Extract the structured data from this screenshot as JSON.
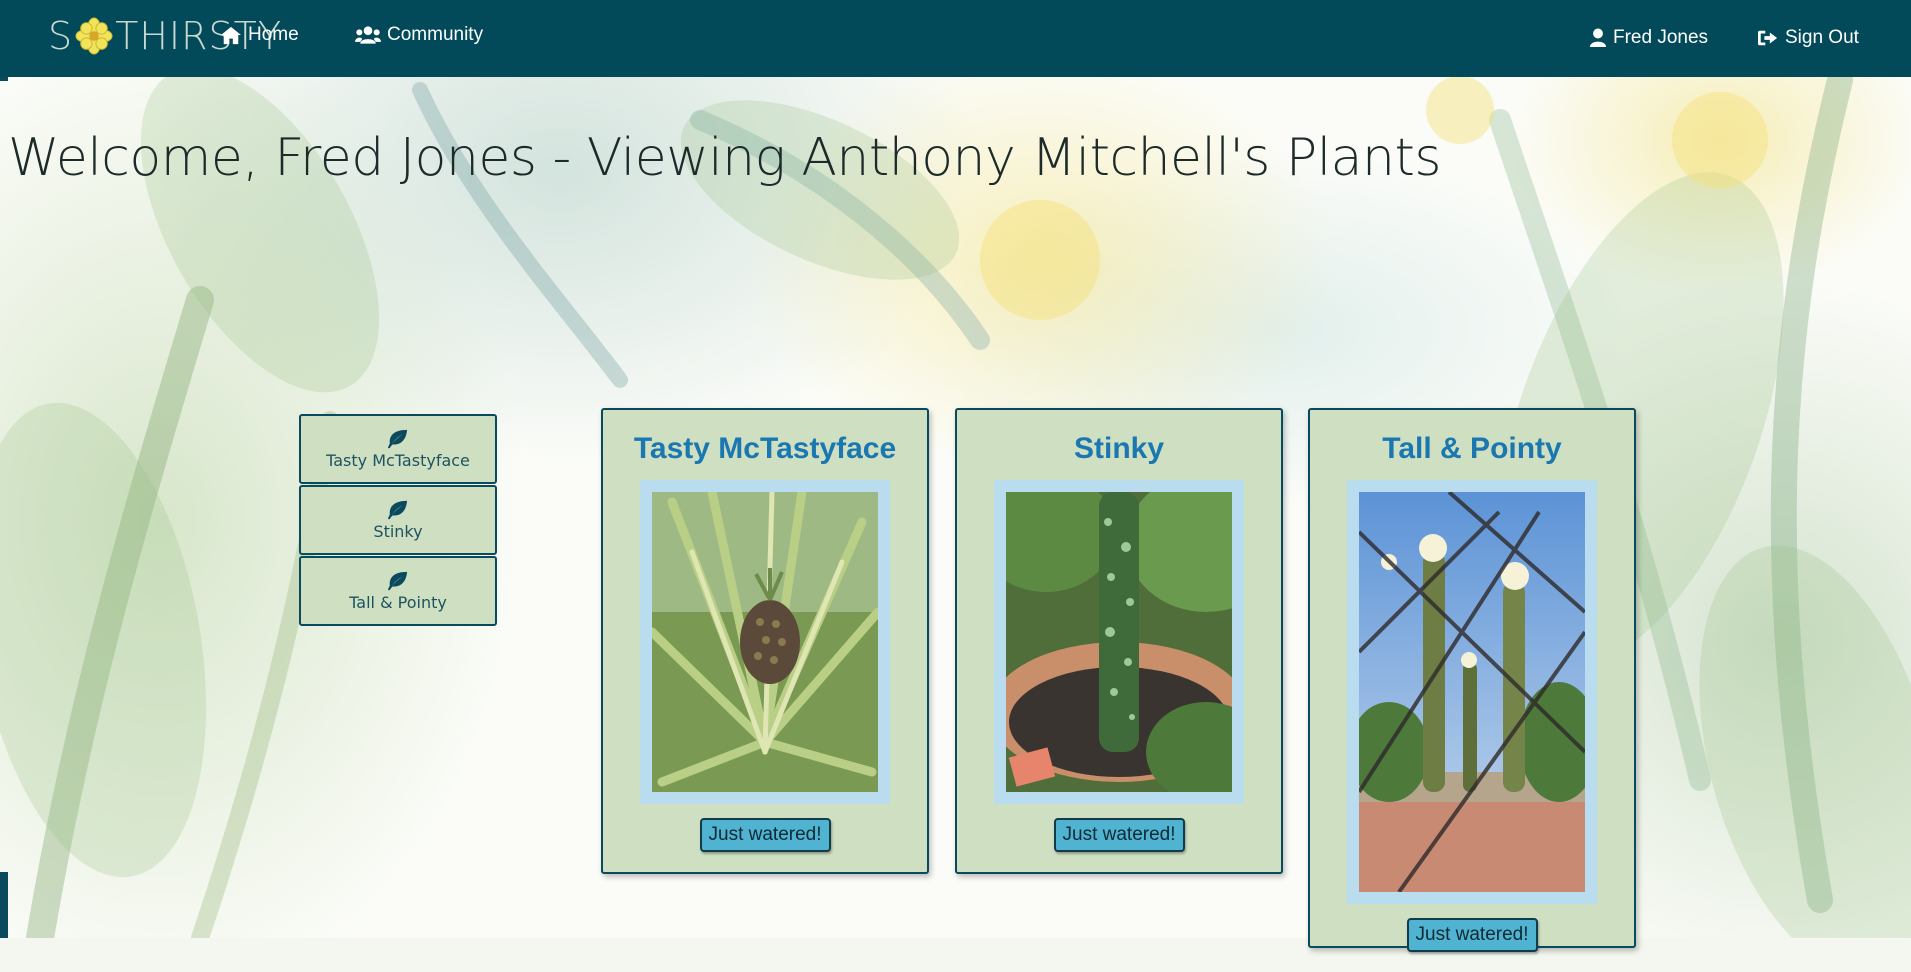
{
  "nav": {
    "logo_prefix": "S",
    "logo_suffix": "THIRSTY",
    "home": "Home",
    "community": "Community",
    "user": "Fred Jones",
    "sign_out": "Sign Out",
    "icons": {
      "home": "home-icon",
      "community": "users-icon",
      "user": "user-icon",
      "sign_out": "sign-out-icon"
    }
  },
  "heading": "Welcome, Fred Jones - Viewing Anthony Mitchell's Plants",
  "sidebar": {
    "items": [
      {
        "label": "Tasty McTastyface",
        "icon": "leaf-icon"
      },
      {
        "label": "Stinky",
        "icon": "leaf-icon"
      },
      {
        "label": "Tall & Pointy",
        "icon": "leaf-icon"
      }
    ]
  },
  "plants": [
    {
      "name": "Tasty McTastyface",
      "button": "Just watered!",
      "photo": "pineapple plant"
    },
    {
      "name": "Stinky",
      "button": "Just watered!",
      "photo": "spotted stalk in pot"
    },
    {
      "name": "Tall & Pointy",
      "button": "Just watered!",
      "photo": "tall cactus behind fence"
    }
  ],
  "colors": {
    "navbar": "#024a5a",
    "card": "#cfdfc2",
    "title": "#1a77b0",
    "button": "#4fb3d1"
  }
}
